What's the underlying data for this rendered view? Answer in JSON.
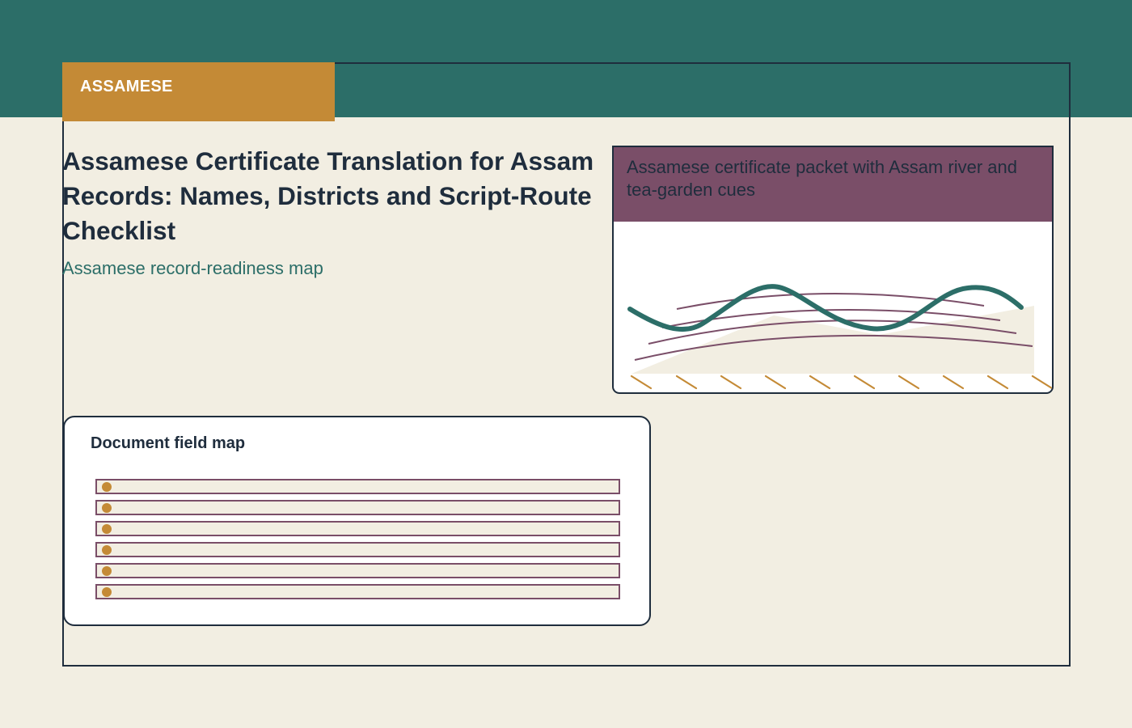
{
  "badge": {
    "label": "ASSAMESE"
  },
  "page": {
    "title": "Assamese Certificate Translation for Assam\nRecords: Names, Districts and Script-Route\nChecklist",
    "subtitle": "Assamese record-readiness map"
  },
  "hero": {
    "caption": "Assamese certificate packet with Assam river and tea-garden cues"
  },
  "field_map": {
    "title": "Document field map",
    "rows": [
      {
        "label": ""
      },
      {
        "label": ""
      },
      {
        "label": ""
      },
      {
        "label": ""
      },
      {
        "label": ""
      },
      {
        "label": ""
      }
    ]
  },
  "colors": {
    "teal": "#2c6e68",
    "gold": "#c48a36",
    "plum": "#7a4e68",
    "navy": "#1f2d3d",
    "cream": "#f2eee2"
  }
}
